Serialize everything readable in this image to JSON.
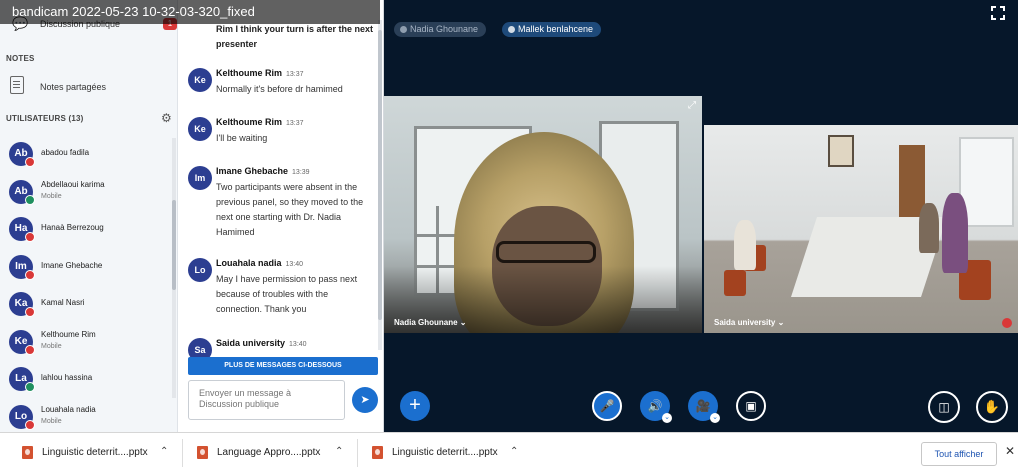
{
  "recorder_title": "bandicam 2022-05-23 10-32-03-320_fixed",
  "sidebar": {
    "public_chat_label": "Discussion publique",
    "public_chat_badge": "1",
    "notes_heading": "NOTES",
    "shared_notes_label": "Notes partagées",
    "users_heading": "UTILISATEURS (13)",
    "users": [
      {
        "initials": "Ab",
        "name": "abadou fadila",
        "sub": "",
        "mobile": false
      },
      {
        "initials": "Ab",
        "name": "Abdellaoui karima",
        "sub": "Mobile",
        "mobile": true
      },
      {
        "initials": "Ha",
        "name": "Hanaà Berrezoug",
        "sub": "",
        "mobile": false
      },
      {
        "initials": "Im",
        "name": "Imane Ghebache",
        "sub": "",
        "mobile": false
      },
      {
        "initials": "Ka",
        "name": "Kamal Nasri",
        "sub": "",
        "mobile": false
      },
      {
        "initials": "Ke",
        "name": "Kelthoume Rim",
        "sub": "Mobile",
        "mobile": false
      },
      {
        "initials": "La",
        "name": "lahlou hassina",
        "sub": "",
        "mobile": true
      },
      {
        "initials": "Lo",
        "name": "Louahala nadia",
        "sub": "Mobile",
        "mobile": false
      }
    ]
  },
  "chat": {
    "top_text": "Rim I think your turn is after the next presenter",
    "messages": [
      {
        "initials": "Ke",
        "name": "Kelthoume Rim",
        "time": "13:37",
        "text": "Normally it's before dr hamimed"
      },
      {
        "initials": "Ke",
        "name": "Kelthoume Rim",
        "time": "13:37",
        "text": "I'll be waiting"
      },
      {
        "initials": "Im",
        "name": "Imane Ghebache",
        "time": "13:39",
        "text": "Two participants were absent in the previous panel, so they moved to the next one starting with Dr. Nadia Hamimed"
      },
      {
        "initials": "Lo",
        "name": "Louahala nadia",
        "time": "13:40",
        "text": "May I have permission to pass next because of troubles with the connection. Thank you"
      },
      {
        "initials": "Sa",
        "name": "Saida university",
        "time": "13:40",
        "text": ""
      }
    ],
    "more_messages_label": "PLUS DE MESSAGES CI-DESSOUS",
    "input_placeholder": "Envoyer un message à Discussion publique"
  },
  "main": {
    "talkers": [
      "Nadia Ghounane",
      "Mallek benlahcene"
    ],
    "videos": [
      {
        "name": "Nadia Ghounane"
      },
      {
        "name": "Saida university"
      }
    ]
  },
  "downloads": {
    "files": [
      "Linguistic deterrit....pptx",
      "Language Appro....pptx",
      "Linguistic deterrit....pptx"
    ],
    "show_all_label": "Tout afficher"
  },
  "colors": {
    "accent": "#1b6fcf",
    "avatar": "#2c3e91",
    "status_red": "#d93838",
    "status_green": "#1f8f5f",
    "main_bg": "#06172a"
  }
}
